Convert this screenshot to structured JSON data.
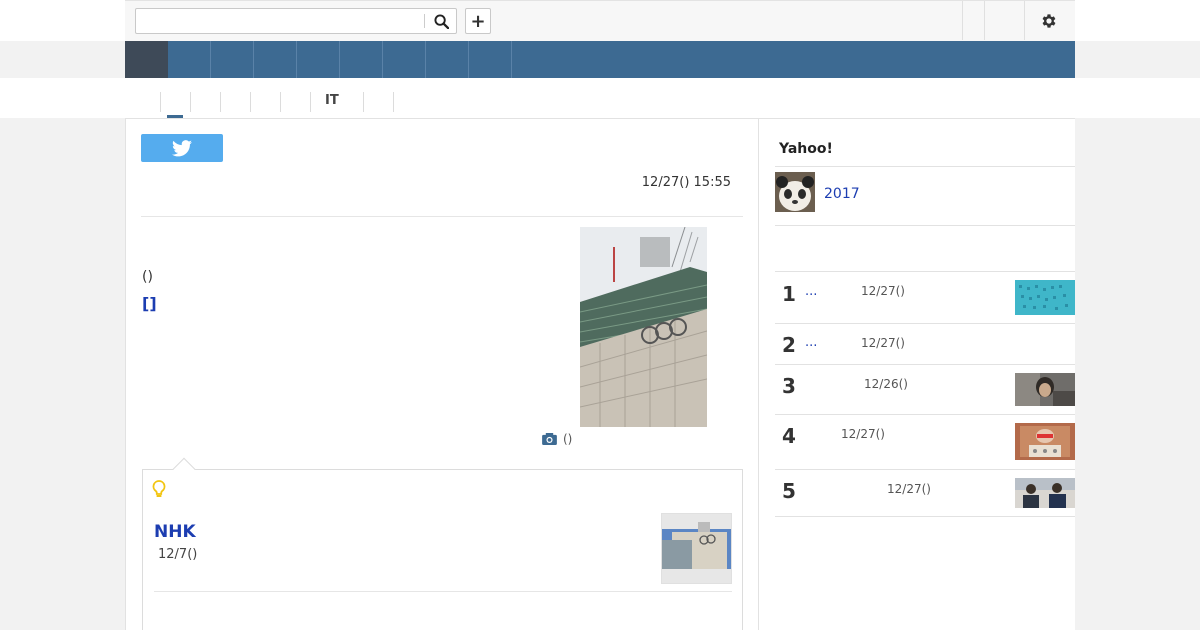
{
  "header": {
    "search_placeholder": "",
    "search_icon": "search-icon",
    "add_label": "+",
    "settings_icon": "gear-icon"
  },
  "nav": {
    "active_index": 0,
    "item_count": 9
  },
  "subnav": {
    "items": [
      "",
      "",
      "",
      "",
      "",
      "IT",
      "",
      ""
    ],
    "active_index": 0
  },
  "article": {
    "share_icon": "twitter-icon",
    "timestamp": "12/27() 15:55",
    "body_line": "()",
    "source_link": "[]",
    "photo_caption": "()",
    "photo_caption_icon": "camera-icon"
  },
  "related": {
    "icon": "lightbulb-icon",
    "title": "NHK",
    "date": "12/7()"
  },
  "sidebar": {
    "title": "Yahoo!",
    "feature_link": "2017",
    "ranking": [
      {
        "rank": "1",
        "link": "...",
        "date": "12/27()",
        "has_thumb": true
      },
      {
        "rank": "2",
        "link": "...",
        "date": "12/27()",
        "has_thumb": false
      },
      {
        "rank": "3",
        "link": "",
        "date": "12/26()",
        "has_thumb": true
      },
      {
        "rank": "4",
        "link": "",
        "date": "12/27()",
        "has_thumb": true
      },
      {
        "rank": "5",
        "link": "",
        "date": "12/27()",
        "has_thumb": true
      }
    ]
  },
  "colors": {
    "nav_blue": "#3d6a92",
    "nav_active": "#3e4a58",
    "link_blue": "#1c3db1",
    "twitter_blue": "#55acee"
  }
}
